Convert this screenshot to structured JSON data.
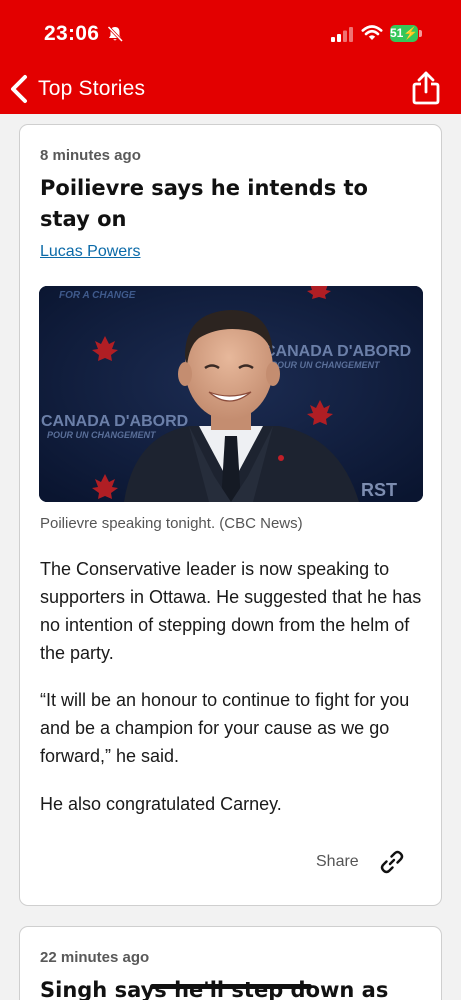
{
  "status_bar": {
    "time": "23:06",
    "battery": "51",
    "icons": [
      "bell-slash-icon",
      "cellular-signal-icon",
      "wifi-icon",
      "battery-charging-icon"
    ]
  },
  "nav": {
    "back_label": "Top Stories",
    "back_icon": "chevron-left-icon",
    "share_icon": "share-icon"
  },
  "colors": {
    "brand_red": "#e30000",
    "link_blue": "#0b6aa8",
    "battery_green": "#35c759"
  },
  "posts": [
    {
      "timestamp": "8 minutes ago",
      "headline": "Poilievre says he intends to stay on",
      "author": "Lucas Powers",
      "image": {
        "backdrop_texts": [
          "FOR A CHANGE",
          "CANADA D'ABORD",
          "POUR UN CHANGEMENT",
          "CANADA D'ABORD",
          "POUR UN CHANGEMENT",
          "RST"
        ]
      },
      "caption": "Poilievre speaking tonight. (CBC News)",
      "paragraphs": [
        "The Conservative leader is now speaking to supporters in Ottawa. He suggested that he has no intention of stepping down from the helm of the party.",
        "“It will be an honour to continue to fight for you and be a champion for your cause as we go forward,” he said.",
        "He also congratulated Carney."
      ],
      "share_label": "Share",
      "share_icon": "link-icon"
    },
    {
      "timestamp": "22 minutes ago",
      "headline": "Singh says he'll step down as"
    }
  ]
}
